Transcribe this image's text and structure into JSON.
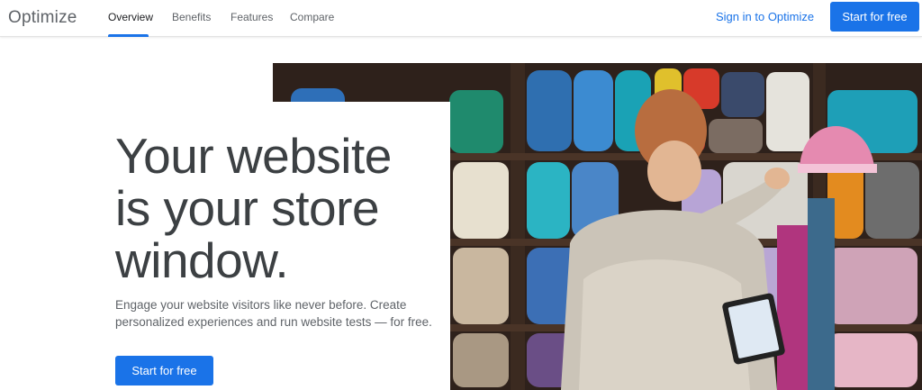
{
  "header": {
    "logo": "Optimize",
    "nav": [
      {
        "label": "Overview",
        "active": true
      },
      {
        "label": "Benefits",
        "active": false
      },
      {
        "label": "Features",
        "active": false
      },
      {
        "label": "Compare",
        "active": false
      }
    ],
    "sign_in": "Sign in to Optimize",
    "cta": "Start for free"
  },
  "hero": {
    "headline": [
      "Your website",
      "is your store",
      "window."
    ],
    "subtext": [
      "Engage your website visitors like never before. Create",
      "personalized experiences and run website tests — for free."
    ],
    "cta": "Start for free"
  },
  "colors": {
    "accent": "#1a73e8",
    "text_dark": "#3c4043",
    "text_muted": "#5f6368"
  }
}
